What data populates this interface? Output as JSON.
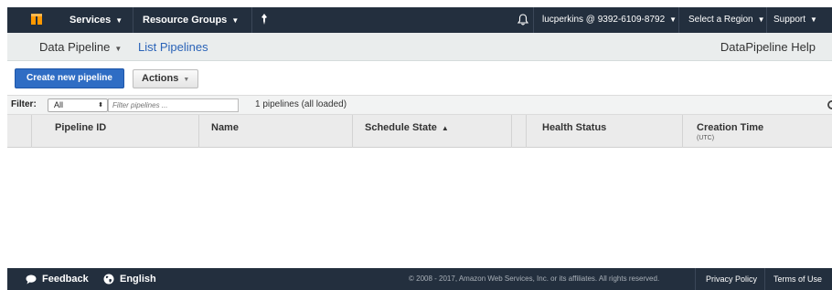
{
  "topnav": {
    "services_label": "Services",
    "resource_groups_label": "Resource Groups",
    "account_label": "lucperkins @ 9392-6109-8792",
    "region_label": "Select a Region",
    "support_label": "Support"
  },
  "servicebar": {
    "service_label": "Data Pipeline",
    "page_label": "List Pipelines",
    "help_label": "DataPipeline Help"
  },
  "toolbar": {
    "create_label": "Create new pipeline",
    "actions_label": "Actions"
  },
  "filter": {
    "label": "Filter:",
    "select_value": "All",
    "input_placeholder": "Filter pipelines ...",
    "count_text": "1 pipelines (all loaded)"
  },
  "table": {
    "columns": [
      "Pipeline ID",
      "Name",
      "Schedule State",
      "Health Status",
      "Creation Time"
    ],
    "creation_time_sub": "(UTC)",
    "rows": []
  },
  "footer": {
    "feedback_label": "Feedback",
    "language_label": "English",
    "copyright": "© 2008 - 2017, Amazon Web Services, Inc. or its affiliates. All rights reserved.",
    "privacy_label": "Privacy Policy",
    "terms_label": "Terms of Use"
  },
  "colors": {
    "nav_bg": "#232f3e",
    "primary_button": "#2f6dc4",
    "link": "#2a63b8",
    "logo": "#f90"
  }
}
